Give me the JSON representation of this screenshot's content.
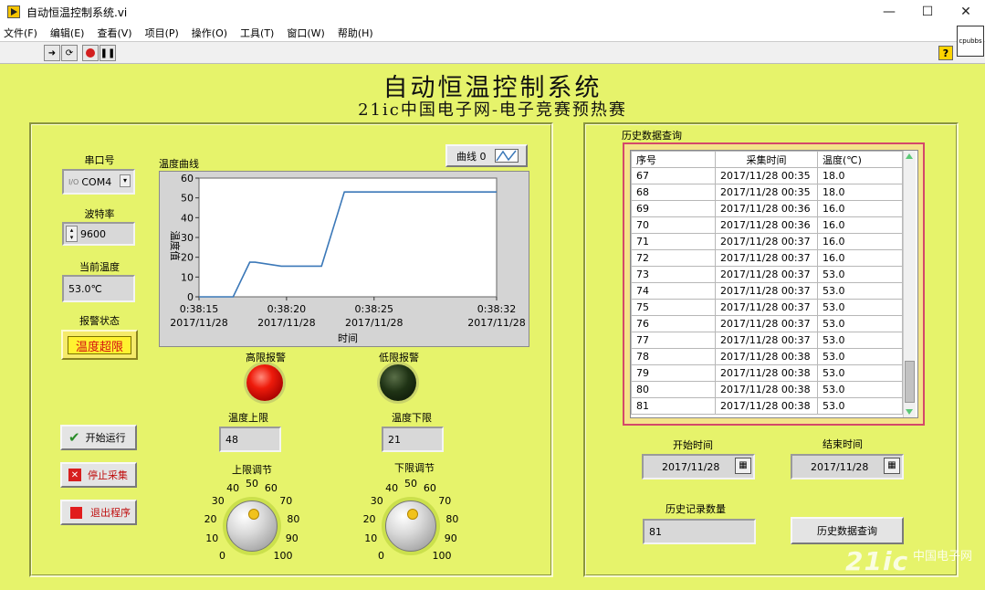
{
  "window": {
    "title": "自动恒温控制系统.vi",
    "minimize": "—",
    "maximize": "☐",
    "close": "✕"
  },
  "menu": [
    "文件(F)",
    "编辑(E)",
    "查看(V)",
    "项目(P)",
    "操作(O)",
    "工具(T)",
    "窗口(W)",
    "帮助(H)"
  ],
  "toolbar": {
    "help": "?",
    "vi_icon_text": "cpubbs"
  },
  "header": {
    "title": "自动恒温控制系统",
    "subtitle": "21ic中国电子网-电子竞赛预热赛"
  },
  "controls": {
    "serial_label": "串口号",
    "serial_value": "COM4",
    "baud_label": "波特率",
    "baud_value": "9600",
    "temp_label": "当前温度",
    "temp_value": "53.0℃",
    "alarm_label": "报警状态",
    "alarm_value": "温度超限",
    "start_button": "开始运行",
    "stop_button": "停止采集",
    "exit_button": "退出程序"
  },
  "chart": {
    "title": "温度曲线",
    "legend": "曲线 0",
    "ylabel": "温度值",
    "xlabel": "时间"
  },
  "chart_data": {
    "type": "line",
    "x": [
      0,
      1.95,
      2.9,
      3.2,
      4.7,
      6.3,
      7.0,
      8.3,
      17.0
    ],
    "values": [
      0,
      0,
      17.5,
      17.5,
      15.5,
      15.5,
      15.5,
      53,
      53
    ],
    "x_ticks": [
      {
        "t": 0,
        "time": "0:38:15",
        "date": "2017/11/28"
      },
      {
        "t": 5,
        "time": "0:38:20",
        "date": "2017/11/28"
      },
      {
        "t": 10,
        "time": "0:38:25",
        "date": "2017/11/28"
      },
      {
        "t": 17,
        "time": "0:38:32",
        "date": "2017/11/28"
      }
    ],
    "y_ticks": [
      "0",
      "10",
      "20",
      "30",
      "40",
      "50",
      "60"
    ],
    "ylim": [
      0,
      60
    ],
    "xlim": [
      0,
      17
    ],
    "color": "#3b78b8"
  },
  "alarms": {
    "high_label": "高限报警",
    "low_label": "低限报警"
  },
  "limits": {
    "upper_label": "温度上限",
    "upper_value": "48",
    "lower_label": "温度下限",
    "lower_value": "21",
    "upper_knob_label": "上限调节",
    "lower_knob_label": "下限调节",
    "knob_scale": [
      "0",
      "10",
      "20",
      "30",
      "40",
      "50",
      "60",
      "70",
      "80",
      "90",
      "100"
    ]
  },
  "history": {
    "title": "历史数据查询",
    "columns": [
      "序号",
      "采集时间",
      "温度(℃)"
    ],
    "rows": [
      [
        "67",
        "2017/11/28 00:35",
        "18.0"
      ],
      [
        "68",
        "2017/11/28 00:35",
        "18.0"
      ],
      [
        "69",
        "2017/11/28 00:36",
        "16.0"
      ],
      [
        "70",
        "2017/11/28 00:36",
        "16.0"
      ],
      [
        "71",
        "2017/11/28 00:37",
        "16.0"
      ],
      [
        "72",
        "2017/11/28 00:37",
        "16.0"
      ],
      [
        "73",
        "2017/11/28 00:37",
        "53.0"
      ],
      [
        "74",
        "2017/11/28 00:37",
        "53.0"
      ],
      [
        "75",
        "2017/11/28 00:37",
        "53.0"
      ],
      [
        "76",
        "2017/11/28 00:37",
        "53.0"
      ],
      [
        "77",
        "2017/11/28 00:37",
        "53.0"
      ],
      [
        "78",
        "2017/11/28 00:38",
        "53.0"
      ],
      [
        "79",
        "2017/11/28 00:38",
        "53.0"
      ],
      [
        "80",
        "2017/11/28 00:38",
        "53.0"
      ],
      [
        "81",
        "2017/11/28 00:38",
        "53.0"
      ]
    ],
    "start_label": "开始时间",
    "start_value": "2017/11/28",
    "end_label": "结束时间",
    "end_value": "2017/11/28",
    "count_label": "历史记录数量",
    "count_value": "81",
    "query_button": "历史数据查询"
  },
  "watermark": {
    "logo": "21ic",
    "text": "中国电子网"
  }
}
